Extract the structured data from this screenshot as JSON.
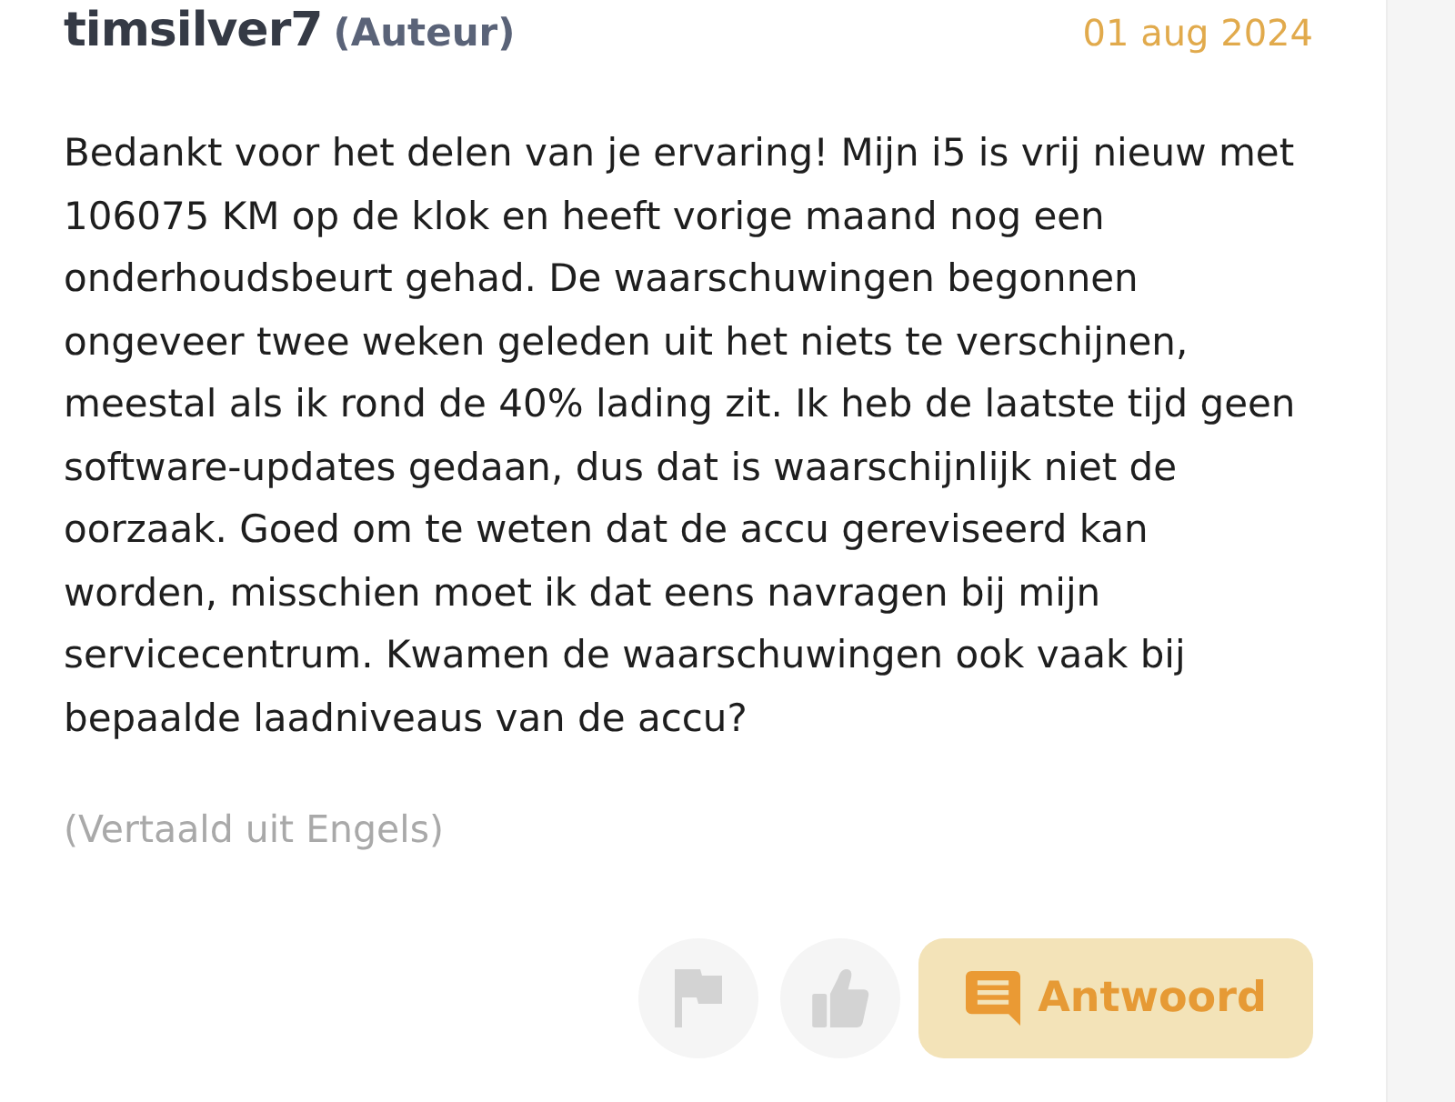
{
  "post": {
    "author": "timsilver7",
    "role": "(Auteur)",
    "date": "01 aug 2024",
    "body": "Bedankt voor het delen van je ervaring! Mijn i5 is vrij nieuw met 106075 KM op de klok en heeft vorige maand nog een onderhoudsbeurt gehad. De waarschuwingen begonnen ongeveer twee weken geleden uit het niets te verschijnen, meestal als ik rond de 40% lading zit. Ik heb de laatste tijd geen software-updates gedaan, dus dat is waarschijnlijk niet de oorzaak. Goed om te weten dat de accu gereviseerd kan worden, misschien moet ik dat eens navragen bij mijn servicecentrum. Kwamen de waarschuwingen ook vaak bij bepaalde laadniveaus van de accu?",
    "translation_note": "(Vertaald uit Engels)"
  },
  "actions": [
    {
      "kind": "flag"
    },
    {
      "kind": "like"
    },
    {
      "kind": "reply",
      "label": "Antwoord"
    }
  ]
}
